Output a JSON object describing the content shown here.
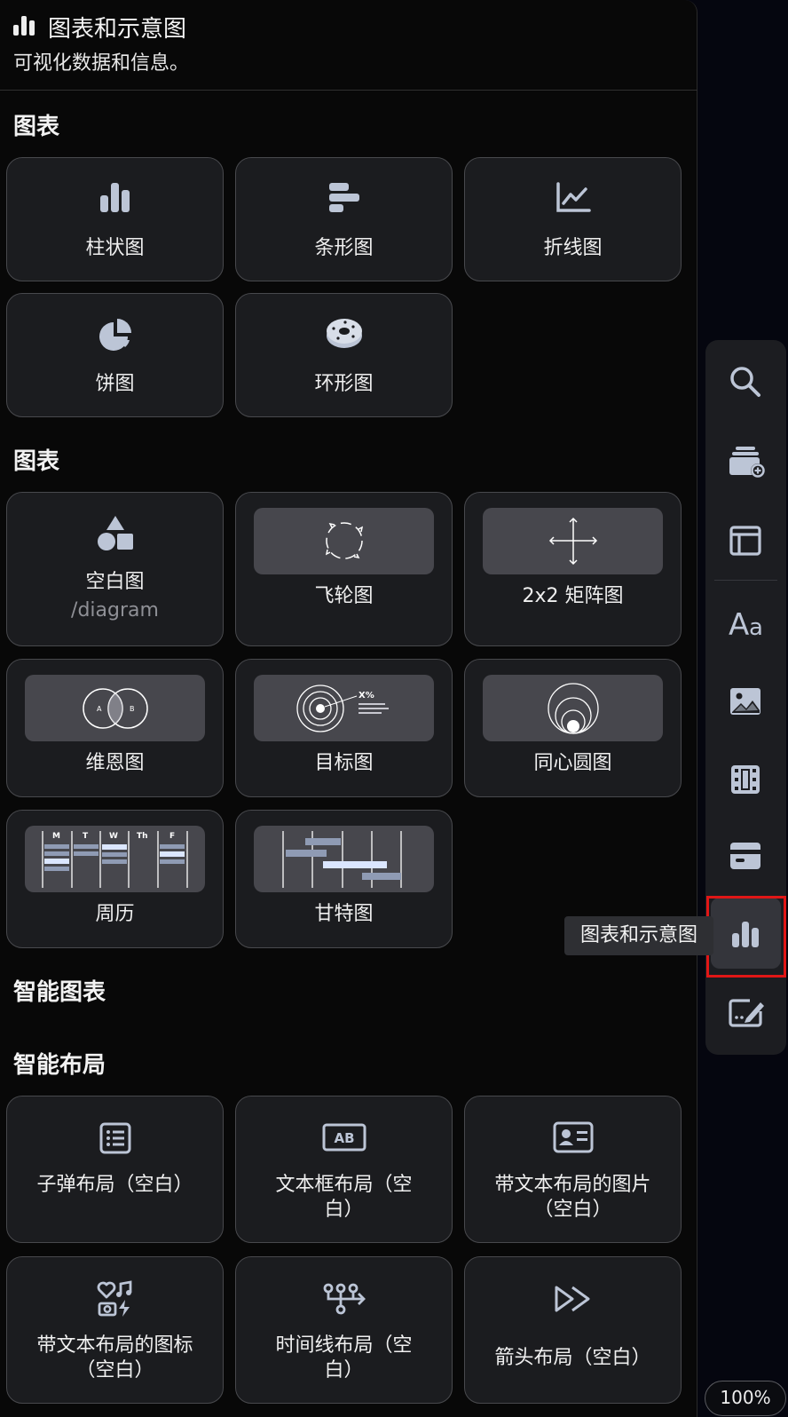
{
  "header": {
    "title": "图表和示意图",
    "subtitle": "可视化数据和信息。"
  },
  "sections": {
    "charts": "图表",
    "diagrams": "图表",
    "smart_charts": "智能图表",
    "smart_layouts": "智能布局"
  },
  "charts": {
    "bar": "柱状图",
    "hbar": "条形图",
    "line": "折线图",
    "pie": "饼图",
    "donut": "环形图"
  },
  "diagrams": {
    "blank": "空白图",
    "blank_cmd": "/diagram",
    "flywheel": "飞轮图",
    "matrix": "2x2 矩阵图",
    "venn": "维恩图",
    "target": "目标图",
    "concentric": "同心圆图",
    "week": "周历",
    "gantt": "甘特图",
    "venn_a": "A",
    "venn_b": "B",
    "target_pct": "X%",
    "week_days": [
      "M",
      "T",
      "W",
      "Th",
      "F"
    ]
  },
  "layouts": {
    "bullets": "子弹布局（空白）",
    "textbox_1": "文本框布局（空",
    "textbox_2": "白）",
    "textbox_icon": "AB",
    "image_text_1": "带文本布局的图片",
    "image_text_2": "（空白）",
    "icons_text_1": "带文本布局的图标",
    "icons_text_2": "（空白）",
    "timeline_1": "时间线布局（空",
    "timeline_2": "白）",
    "arrows": "箭头布局（空白）"
  },
  "rail": {
    "tooltip": "图表和示意图",
    "items": [
      "search-icon",
      "add-card-icon",
      "layout-icon",
      "text-icon",
      "image-icon",
      "video-icon",
      "embed-icon",
      "chart-icon",
      "form-icon"
    ],
    "active": "chart-icon"
  },
  "zoom": "100%",
  "colors": {
    "accent_icon": "#bcc5d6",
    "card_bg": "#1b1c1f",
    "highlight": "#e01616"
  }
}
